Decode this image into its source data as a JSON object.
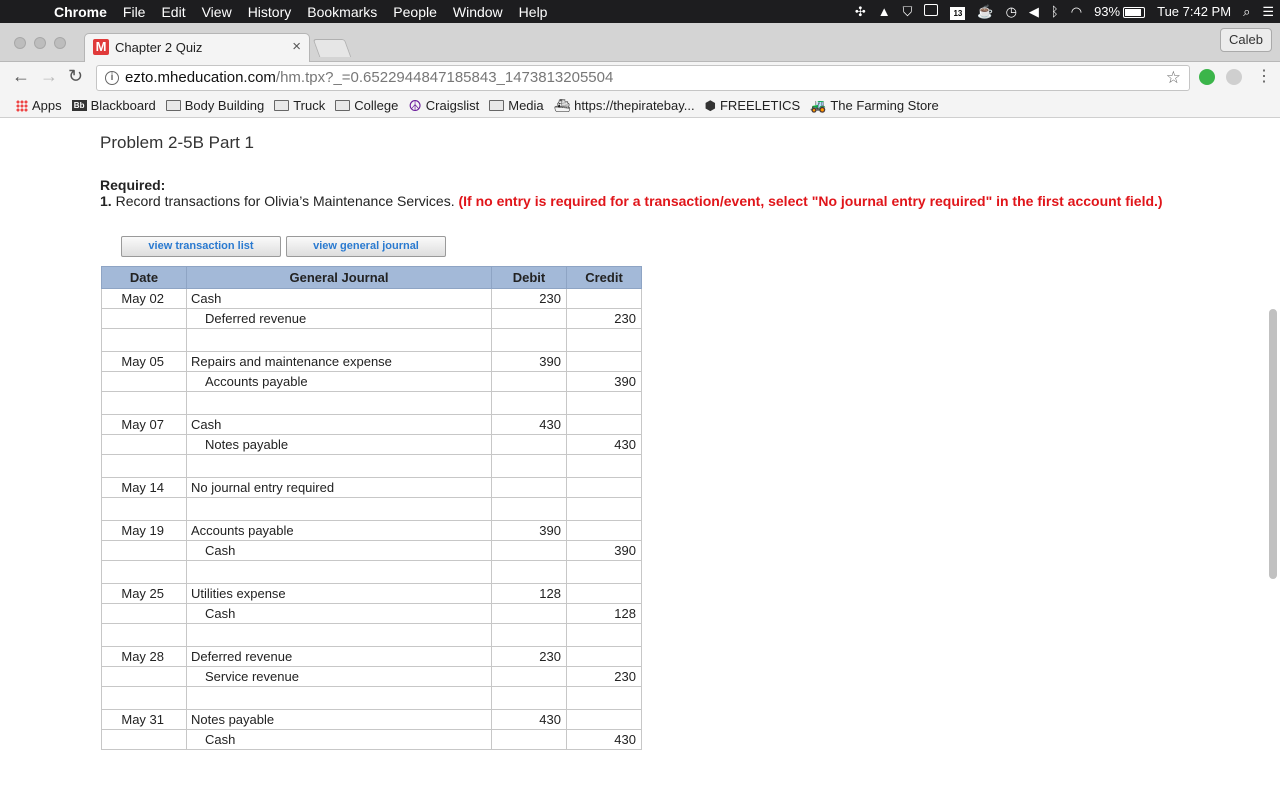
{
  "menubar": {
    "app": "Chrome",
    "items": [
      "File",
      "Edit",
      "View",
      "History",
      "Bookmarks",
      "People",
      "Window",
      "Help"
    ],
    "calendar_day": "13",
    "battery": "93%",
    "clock": "Tue 7:42 PM"
  },
  "browser": {
    "tab_title": "Chapter 2 Quiz",
    "tab_favicon": "M",
    "profile": "Caleb",
    "url_host": "ezto.mheducation.com",
    "url_path": "/hm.tpx?_=0.6522944847185843_1473813205504"
  },
  "bookmarks": [
    {
      "label": "Apps",
      "icon": "apps-grid-icon"
    },
    {
      "label": "Blackboard",
      "icon": "blackboard-icon"
    },
    {
      "label": "Body Building",
      "icon": "folder-icon"
    },
    {
      "label": "Truck",
      "icon": "folder-icon"
    },
    {
      "label": "College",
      "icon": "folder-icon"
    },
    {
      "label": "Craigslist",
      "icon": "peace-icon"
    },
    {
      "label": "Media",
      "icon": "folder-icon"
    },
    {
      "label": "https://thepiratebay...",
      "icon": "pirate-ship-icon"
    },
    {
      "label": "FREELETICS",
      "icon": "freeletics-icon"
    },
    {
      "label": "The Farming Store",
      "icon": "tractor-icon"
    }
  ],
  "page": {
    "title": "Problem 2-5B Part 1",
    "required_label": "Required:",
    "instruction_number": "1.",
    "instruction_text": "Record transactions for Olivia’s Maintenance Services.",
    "instruction_note": "(If no entry is required for a transaction/event, select \"No journal entry required\" in the first account field.)",
    "buttons": {
      "transaction_list": "view transaction list",
      "general_journal": "view general journal"
    },
    "table": {
      "headers": [
        "Date",
        "General Journal",
        "Debit",
        "Credit"
      ],
      "entries": [
        {
          "date": "May 02",
          "lines": [
            {
              "account": "Cash",
              "debit": "230",
              "credit": ""
            },
            {
              "account": "Deferred revenue",
              "debit": "",
              "credit": "230"
            }
          ]
        },
        {
          "date": "May 05",
          "lines": [
            {
              "account": "Repairs and maintenance expense",
              "debit": "390",
              "credit": ""
            },
            {
              "account": "Accounts payable",
              "debit": "",
              "credit": "390"
            }
          ]
        },
        {
          "date": "May 07",
          "lines": [
            {
              "account": "Cash",
              "debit": "430",
              "credit": ""
            },
            {
              "account": "Notes payable",
              "debit": "",
              "credit": "430"
            }
          ]
        },
        {
          "date": "May 14",
          "lines": [
            {
              "account": "No journal entry required",
              "debit": "",
              "credit": ""
            }
          ]
        },
        {
          "date": "May 19",
          "lines": [
            {
              "account": "Accounts payable",
              "debit": "390",
              "credit": ""
            },
            {
              "account": "Cash",
              "debit": "",
              "credit": "390"
            }
          ]
        },
        {
          "date": "May 25",
          "lines": [
            {
              "account": "Utilities expense",
              "debit": "128",
              "credit": ""
            },
            {
              "account": "Cash",
              "debit": "",
              "credit": "128"
            }
          ]
        },
        {
          "date": "May 28",
          "lines": [
            {
              "account": "Deferred revenue",
              "debit": "230",
              "credit": ""
            },
            {
              "account": "Service revenue",
              "debit": "",
              "credit": "230"
            }
          ]
        },
        {
          "date": "May 31",
          "lines": [
            {
              "account": "Notes payable",
              "debit": "430",
              "credit": ""
            },
            {
              "account": "Cash",
              "debit": "",
              "credit": "430"
            }
          ]
        }
      ]
    }
  },
  "colors": {
    "table_header": "#a3b9d8",
    "instruction_red": "#e0151a",
    "button_text": "#2a7ad0"
  }
}
